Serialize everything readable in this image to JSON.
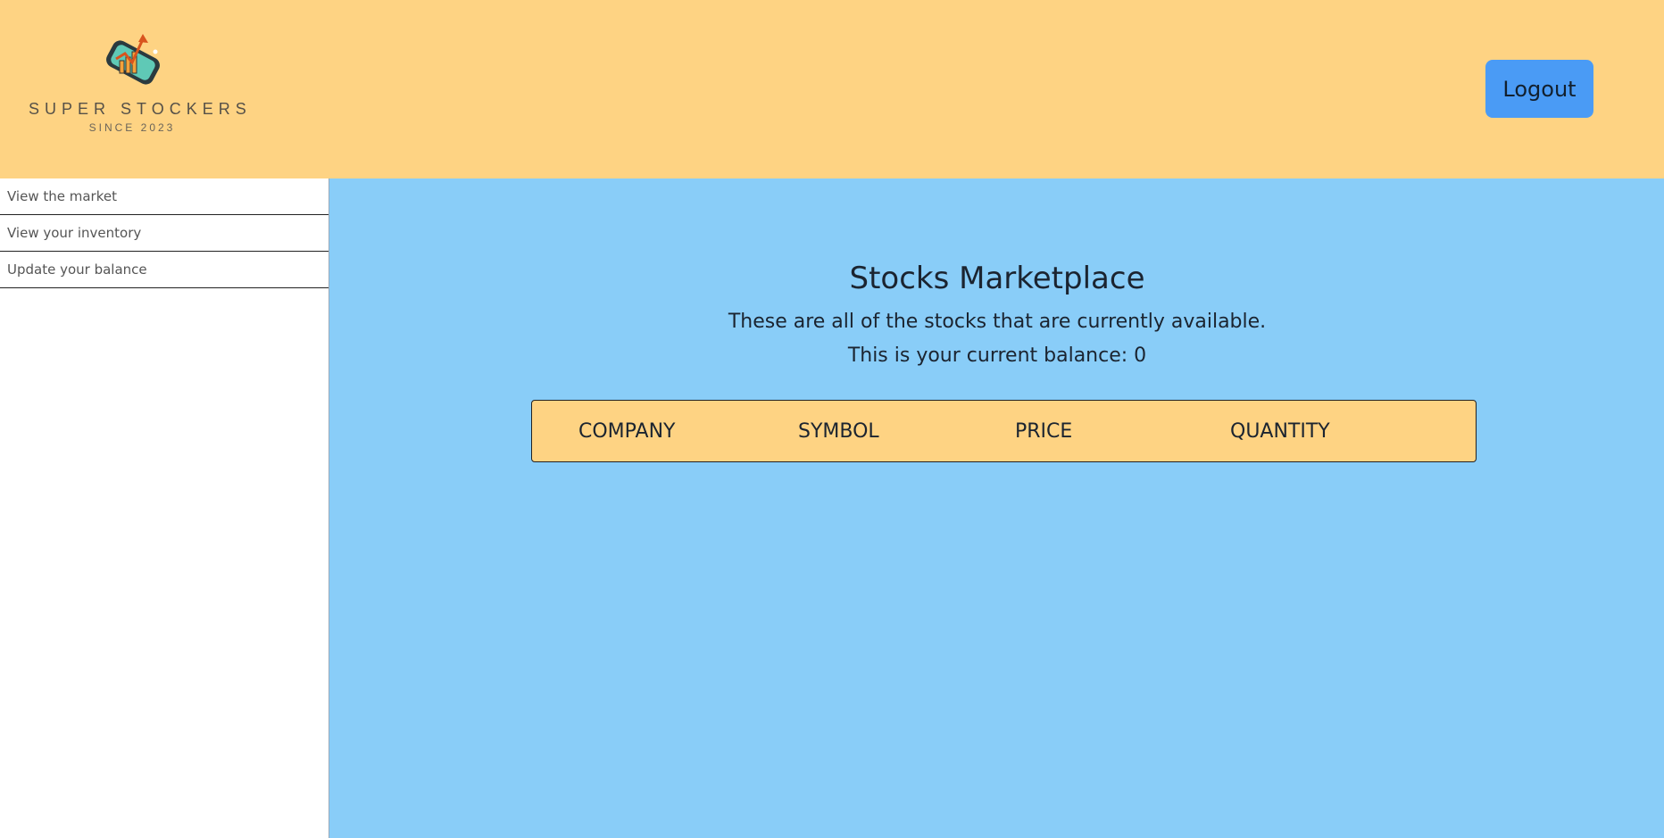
{
  "header": {
    "logo": {
      "name": "SUPER STOCKERS",
      "since": "SINCE 2023",
      "icon": "stock-phone-chart-icon"
    },
    "logout_label": "Logout"
  },
  "sidebar": {
    "items": [
      {
        "label": "View the market"
      },
      {
        "label": "View your inventory"
      },
      {
        "label": "Update your balance"
      }
    ]
  },
  "main": {
    "title": "Stocks Marketplace",
    "subtitle": "These are all of the stocks that are currently available.",
    "balance_text": "This is your current balance: 0"
  },
  "table": {
    "columns": [
      "COMPANY",
      "SYMBOL",
      "PRICE",
      "QUANTITY"
    ],
    "rows": []
  },
  "colors": {
    "header_bg": "#fed383",
    "main_bg": "#89cdf8",
    "button_bg": "#4a9bf5",
    "sidebar_bg": "#ffffff"
  }
}
